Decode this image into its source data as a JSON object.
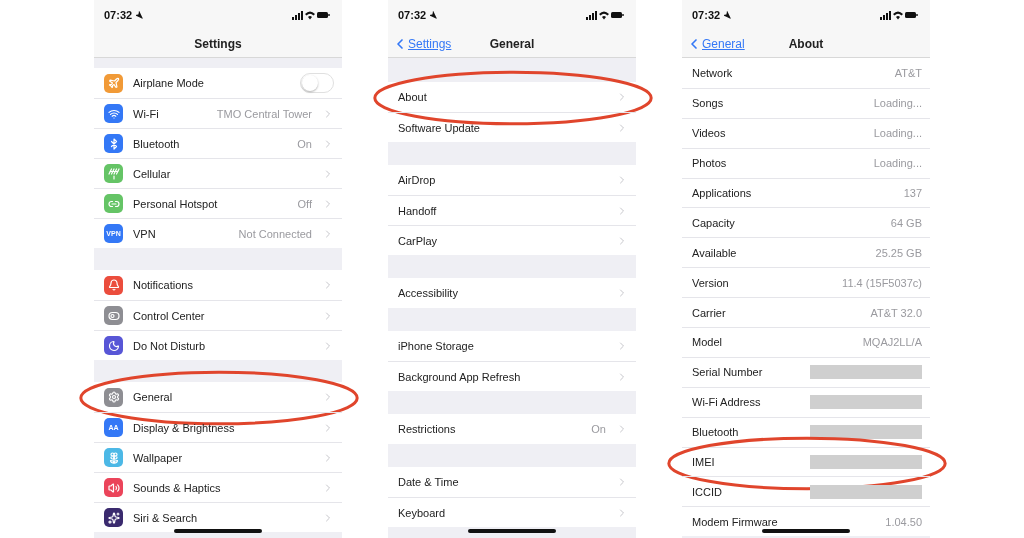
{
  "screens": [
    {
      "status_time": "07:32",
      "title": "Settings",
      "groups": [
        {
          "rows": [
            {
              "label": "Airplane Mode",
              "kind": "toggle",
              "on": false,
              "color": "#f19a37",
              "highlighted": false
            },
            {
              "label": "Wi-Fi",
              "value": "TMO Central Tower",
              "kind": "link",
              "color": "#3478f6",
              "highlighted": false
            },
            {
              "label": "Bluetooth",
              "value": "On",
              "kind": "link",
              "color": "#3478f6",
              "highlighted": false
            },
            {
              "label": "Cellular",
              "kind": "link",
              "color": "#65c466",
              "highlighted": false
            },
            {
              "label": "Personal Hotspot",
              "value": "Off",
              "kind": "link",
              "color": "#65c466",
              "highlighted": false
            },
            {
              "label": "VPN",
              "value": "Not Connected",
              "kind": "link",
              "color": "#3478f6",
              "icon_text": "VPN",
              "highlighted": false
            }
          ]
        },
        {
          "rows": [
            {
              "label": "Notifications",
              "kind": "link",
              "color": "#eb4d3d",
              "highlighted": false
            },
            {
              "label": "Control Center",
              "kind": "link",
              "color": "#8e8e93",
              "highlighted": false
            },
            {
              "label": "Do Not Disturb",
              "kind": "link",
              "color": "#5856d6",
              "highlighted": false
            }
          ]
        },
        {
          "rows": [
            {
              "label": "General",
              "kind": "link",
              "color": "#8e8e93",
              "highlighted": true
            },
            {
              "label": "Display & Brightness",
              "kind": "link",
              "color": "#3478f6",
              "icon_text": "AA",
              "highlighted": false
            },
            {
              "label": "Wallpaper",
              "kind": "link",
              "color": "#4cb8e6",
              "highlighted": false
            },
            {
              "label": "Sounds & Haptics",
              "kind": "link",
              "color": "#eb445a",
              "highlighted": false
            },
            {
              "label": "Siri & Search",
              "kind": "link",
              "color": "#3a2a6e",
              "highlighted": false
            }
          ]
        }
      ]
    },
    {
      "status_time": "07:32",
      "back": "Settings",
      "title": "General",
      "groups": [
        {
          "rows": [
            {
              "label": "About",
              "kind": "link",
              "highlighted": true
            },
            {
              "label": "Software Update",
              "kind": "link",
              "highlighted": false
            }
          ]
        },
        {
          "rows": [
            {
              "label": "AirDrop",
              "kind": "link",
              "highlighted": false
            },
            {
              "label": "Handoff",
              "kind": "link",
              "highlighted": false
            },
            {
              "label": "CarPlay",
              "kind": "link",
              "highlighted": false
            }
          ]
        },
        {
          "rows": [
            {
              "label": "Accessibility",
              "kind": "link",
              "highlighted": false
            }
          ]
        },
        {
          "rows": [
            {
              "label": "iPhone Storage",
              "kind": "link",
              "highlighted": false
            },
            {
              "label": "Background App Refresh",
              "kind": "link",
              "highlighted": false
            }
          ]
        },
        {
          "rows": [
            {
              "label": "Restrictions",
              "value": "On",
              "kind": "link",
              "highlighted": false
            }
          ]
        },
        {
          "rows": [
            {
              "label": "Date & Time",
              "kind": "link",
              "highlighted": false
            },
            {
              "label": "Keyboard",
              "kind": "link",
              "highlighted": false
            }
          ]
        }
      ]
    },
    {
      "status_time": "07:32",
      "back": "General",
      "title": "About",
      "groups": [
        {
          "rows": [
            {
              "label": "Network",
              "value": "AT&T",
              "kind": "info",
              "highlighted": false
            },
            {
              "label": "Songs",
              "value": "Loading...",
              "kind": "info",
              "highlighted": false
            },
            {
              "label": "Videos",
              "value": "Loading...",
              "kind": "info",
              "highlighted": false
            },
            {
              "label": "Photos",
              "value": "Loading...",
              "kind": "info",
              "highlighted": false
            },
            {
              "label": "Applications",
              "value": "137",
              "kind": "info",
              "highlighted": false
            },
            {
              "label": "Capacity",
              "value": "64 GB",
              "kind": "info",
              "highlighted": false
            },
            {
              "label": "Available",
              "value": "25.25 GB",
              "kind": "info",
              "highlighted": false
            },
            {
              "label": "Version",
              "value": "11.4 (15F5037c)",
              "kind": "info",
              "highlighted": false
            },
            {
              "label": "Carrier",
              "value": "AT&T 32.0",
              "kind": "info",
              "highlighted": false
            },
            {
              "label": "Model",
              "value": "MQAJ2LL/A",
              "kind": "info",
              "highlighted": false
            },
            {
              "label": "Serial Number",
              "kind": "redacted",
              "highlighted": false
            },
            {
              "label": "Wi-Fi Address",
              "kind": "redacted",
              "highlighted": false
            },
            {
              "label": "Bluetooth",
              "kind": "redacted",
              "highlighted": false
            },
            {
              "label": "IMEI",
              "kind": "redacted",
              "highlighted": true
            },
            {
              "label": "ICCID",
              "kind": "redacted",
              "highlighted": false
            },
            {
              "label": "Modem Firmware",
              "value": "1.04.50",
              "kind": "info",
              "highlighted": false
            }
          ]
        }
      ]
    }
  ]
}
